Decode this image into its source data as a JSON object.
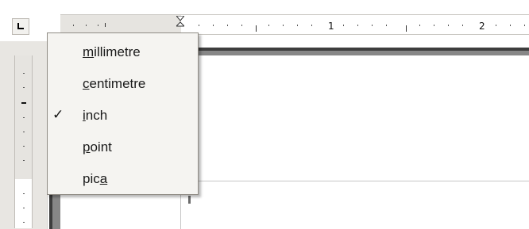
{
  "ruler": {
    "numbers": [
      "1",
      "2"
    ]
  },
  "units_menu": {
    "items": [
      {
        "pre": "",
        "key": "m",
        "post": "illimetre",
        "checked": false
      },
      {
        "pre": "",
        "key": "c",
        "post": "entimetre",
        "checked": false
      },
      {
        "pre": "",
        "key": "i",
        "post": "nch",
        "checked": true
      },
      {
        "pre": "",
        "key": "p",
        "post": "oint",
        "checked": false
      },
      {
        "pre": "pic",
        "key": "a",
        "post": "",
        "checked": false
      }
    ],
    "check_glyph": "✓"
  },
  "icons": {
    "corner": "tab-stop-icon",
    "indent": "indent-marker-icon",
    "check": "checkmark-icon"
  }
}
